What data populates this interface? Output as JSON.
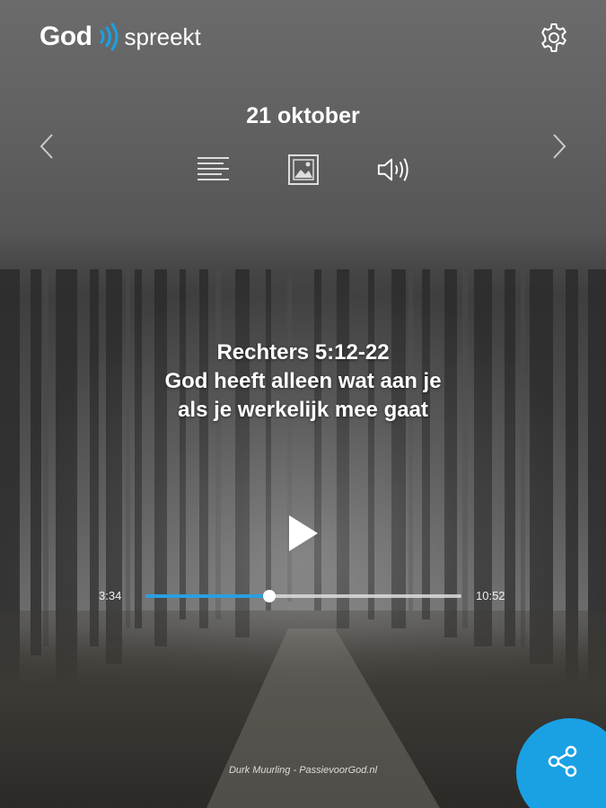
{
  "header": {
    "logo_primary": "God",
    "logo_secondary": "spreekt",
    "settings_icon": "gear-icon"
  },
  "devotional": {
    "date": "21 oktober",
    "prev_icon": "chevron-left-icon",
    "next_icon": "chevron-right-icon",
    "modes": [
      {
        "icon": "text-lines-icon"
      },
      {
        "icon": "image-icon"
      },
      {
        "icon": "speaker-icon"
      }
    ],
    "reference": "Rechters 5:12-22",
    "title_line1": "God heeft alleen wat aan je",
    "title_line2": "als je werkelijk mee gaat"
  },
  "player": {
    "current_time": "3:34",
    "total_time": "10:52",
    "progress": 0.393,
    "play_icon": "play-icon"
  },
  "footer": {
    "credit": "Durk Muurling - PassievoorGod.nl",
    "share_icon": "share-icon"
  },
  "colors": {
    "accent": "#1aa1e4"
  }
}
